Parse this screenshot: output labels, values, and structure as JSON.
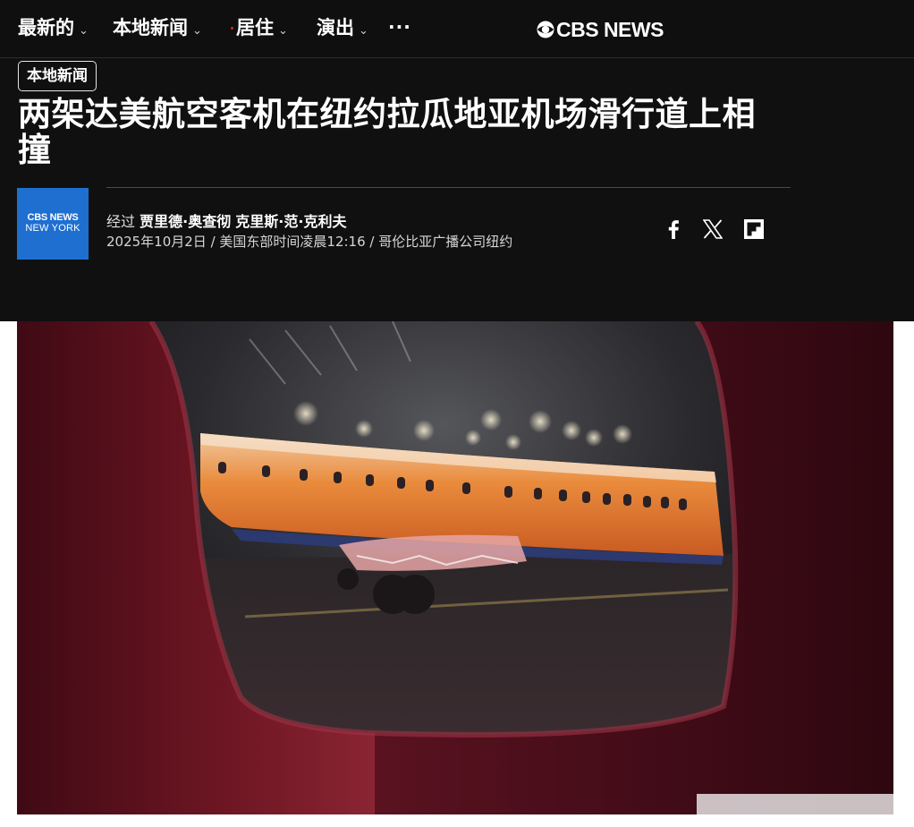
{
  "nav": {
    "items": [
      {
        "label": "最新的"
      },
      {
        "label": "本地新闻"
      },
      {
        "label": "居住"
      },
      {
        "label": "演出"
      }
    ],
    "more": "···",
    "logo": "CBS NEWS"
  },
  "article": {
    "section": "本地新闻",
    "headline": "两架达美航空客机在纽约拉瓜地亚机场滑行道上相撞",
    "byline_prefix": "经过",
    "authors": [
      "贾里德·奥查彻",
      "克里斯·范·克利夫"
    ],
    "dateline": "2025年10月2日 / 美国东部时间凌晨12:16 / 哥伦比亚广播公司纽约"
  },
  "avatar": {
    "brand": "CBS NEWS",
    "city": "NEW YORK"
  },
  "share": [
    "facebook-icon",
    "x-icon",
    "flipboard-icon"
  ],
  "colors": {
    "background": "#101010",
    "avatar_blue": "#1f6fd1",
    "fuselage": "#e0762a"
  }
}
